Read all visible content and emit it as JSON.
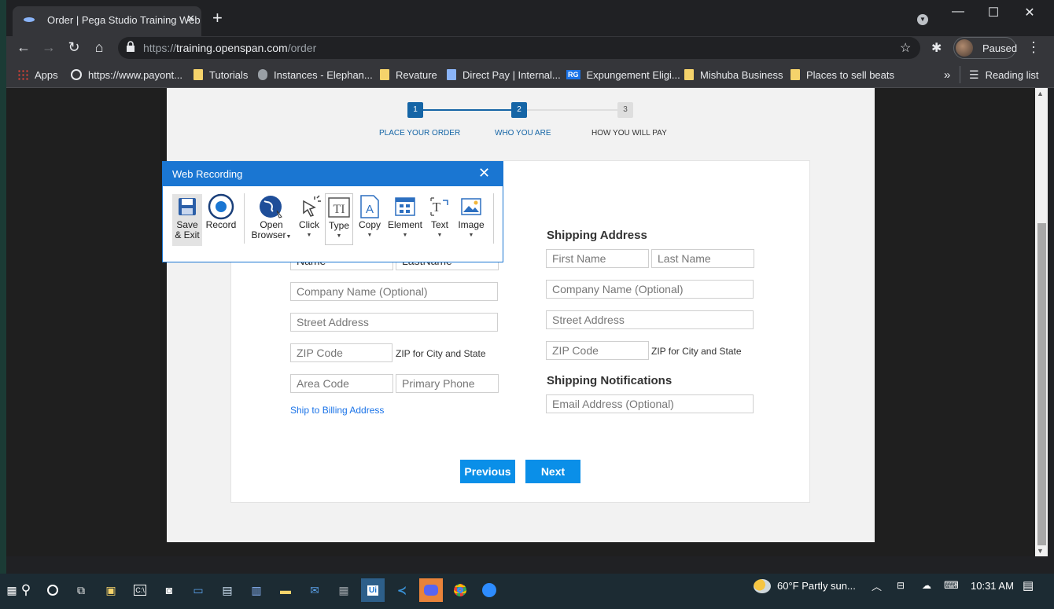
{
  "browser": {
    "tab_title": "Order | Pega Studio Training Web",
    "tab_close": "✕",
    "new_tab": "+",
    "url_prefix": "https://",
    "url_host": "training.openspan.com",
    "url_path": "/order",
    "profile_label": "Paused",
    "window_buttons": [
      "—",
      "☐",
      "✕"
    ]
  },
  "bookmarks": [
    {
      "label": "Apps",
      "icon": "apps-grid-icon"
    },
    {
      "label": "https://www.payont...",
      "icon": "globe-icon"
    },
    {
      "label": "Tutorials",
      "icon": "folder-icon"
    },
    {
      "label": "Instances - Elephan...",
      "icon": "elephant-icon"
    },
    {
      "label": "Revature",
      "icon": "folder-icon"
    },
    {
      "label": "Direct Pay | Internal...",
      "icon": "site-icon"
    },
    {
      "label": "Expungement Eligi...",
      "icon": "rg-icon"
    },
    {
      "label": "Mishuba Business",
      "icon": "folder-icon"
    },
    {
      "label": "Places to sell beats",
      "icon": "folder-icon"
    }
  ],
  "bookmarks_overflow": "»",
  "reading_list": "Reading list",
  "stepper": {
    "steps": [
      {
        "num": "1",
        "label": "PLACE YOUR ORDER",
        "state": "done"
      },
      {
        "num": "2",
        "label": "WHO YOU ARE",
        "state": "current"
      },
      {
        "num": "3",
        "label": "HOW YOU WILL PAY",
        "state": "todo"
      }
    ],
    "active_color": "#1565a6",
    "inactive_color": "#dedede"
  },
  "billing": {
    "first_name": "Name",
    "last_name": "LastName",
    "company": "Company Name (Optional)",
    "street": "Street Address",
    "zip": "ZIP Code",
    "zip_hint": "ZIP for City and State",
    "area_code": "Area Code",
    "phone": "Primary Phone",
    "ship_link": "Ship to Billing Address"
  },
  "shipping": {
    "title": "Shipping Address",
    "first_name": "First Name",
    "last_name": "Last Name",
    "company": "Company Name (Optional)",
    "street": "Street Address",
    "zip": "ZIP Code",
    "zip_hint": "ZIP for City and State",
    "notif_title": "Shipping Notifications",
    "email": "Email Address (Optional)"
  },
  "buttons": {
    "previous": "Previous",
    "next": "Next",
    "color": "#0a8fe8"
  },
  "web_recording": {
    "title": "Web Recording",
    "close": "✕",
    "tools": [
      {
        "l1": "Save",
        "l2": "& Exit"
      },
      {
        "l1": "Record",
        "l2": ""
      },
      {
        "l1": "Open",
        "l2": "Browser"
      },
      {
        "l1": "Click",
        "l2": ""
      },
      {
        "l1": "Type",
        "l2": ""
      },
      {
        "l1": "Copy",
        "l2": ""
      },
      {
        "l1": "Element",
        "l2": ""
      },
      {
        "l1": "Text",
        "l2": ""
      },
      {
        "l1": "Image",
        "l2": ""
      }
    ]
  },
  "taskbar": {
    "weather": "60°F  Partly sun...",
    "time": "10:31 AM"
  }
}
